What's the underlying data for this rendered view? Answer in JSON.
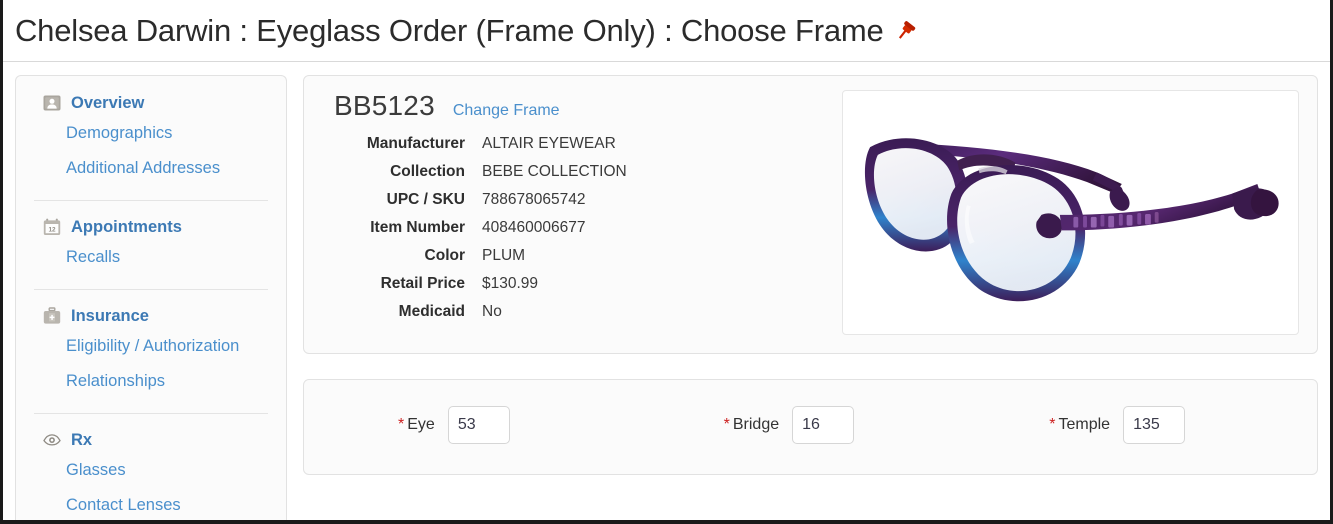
{
  "header": {
    "title": "Chelsea Darwin : Eyeglass Order (Frame Only) : Choose Frame",
    "pin_icon": "pushpin-icon",
    "pin_color": "#cc2200"
  },
  "sidebar": {
    "groups": [
      {
        "icon": "person-card-icon",
        "label": "Overview",
        "items": [
          {
            "label": "Demographics"
          },
          {
            "label": "Additional Addresses"
          }
        ]
      },
      {
        "icon": "calendar-icon",
        "label": "Appointments",
        "calendar_day": "12",
        "items": [
          {
            "label": "Recalls"
          }
        ]
      },
      {
        "icon": "medical-bag-icon",
        "label": "Insurance",
        "items": [
          {
            "label": "Eligibility / Authorization"
          },
          {
            "label": "Relationships"
          }
        ]
      },
      {
        "icon": "eye-icon",
        "label": "Rx",
        "items": [
          {
            "label": "Glasses"
          },
          {
            "label": "Contact Lenses"
          }
        ]
      }
    ]
  },
  "frame": {
    "code": "BB5123",
    "change_link": "Change Frame",
    "specs": [
      {
        "label": "Manufacturer",
        "value": "ALTAIR EYEWEAR"
      },
      {
        "label": "Collection",
        "value": "BEBE COLLECTION"
      },
      {
        "label": "UPC / SKU",
        "value": "788678065742"
      },
      {
        "label": "Item Number",
        "value": "408460006677"
      },
      {
        "label": "Color",
        "value": "PLUM"
      },
      {
        "label": "Retail Price",
        "value": "$130.99"
      },
      {
        "label": "Medicaid",
        "value": "No"
      }
    ],
    "image": {
      "name": "eyeglass-frame-photo",
      "frame_color_primary": "#4a2468",
      "frame_color_accent": "#2a7fc9",
      "frame_color_dark": "#2d1340"
    }
  },
  "measurements": {
    "required_marker": "*",
    "fields": [
      {
        "label": "Eye",
        "value": "53"
      },
      {
        "label": "Bridge",
        "value": "16"
      },
      {
        "label": "Temple",
        "value": "135"
      }
    ]
  },
  "colors": {
    "link_blue": "#4a8fcc",
    "heading_blue": "#3c79b4",
    "panel_bg": "#fbfbfb",
    "panel_border": "#e2e2e2",
    "required_red": "#cc1f1f"
  }
}
